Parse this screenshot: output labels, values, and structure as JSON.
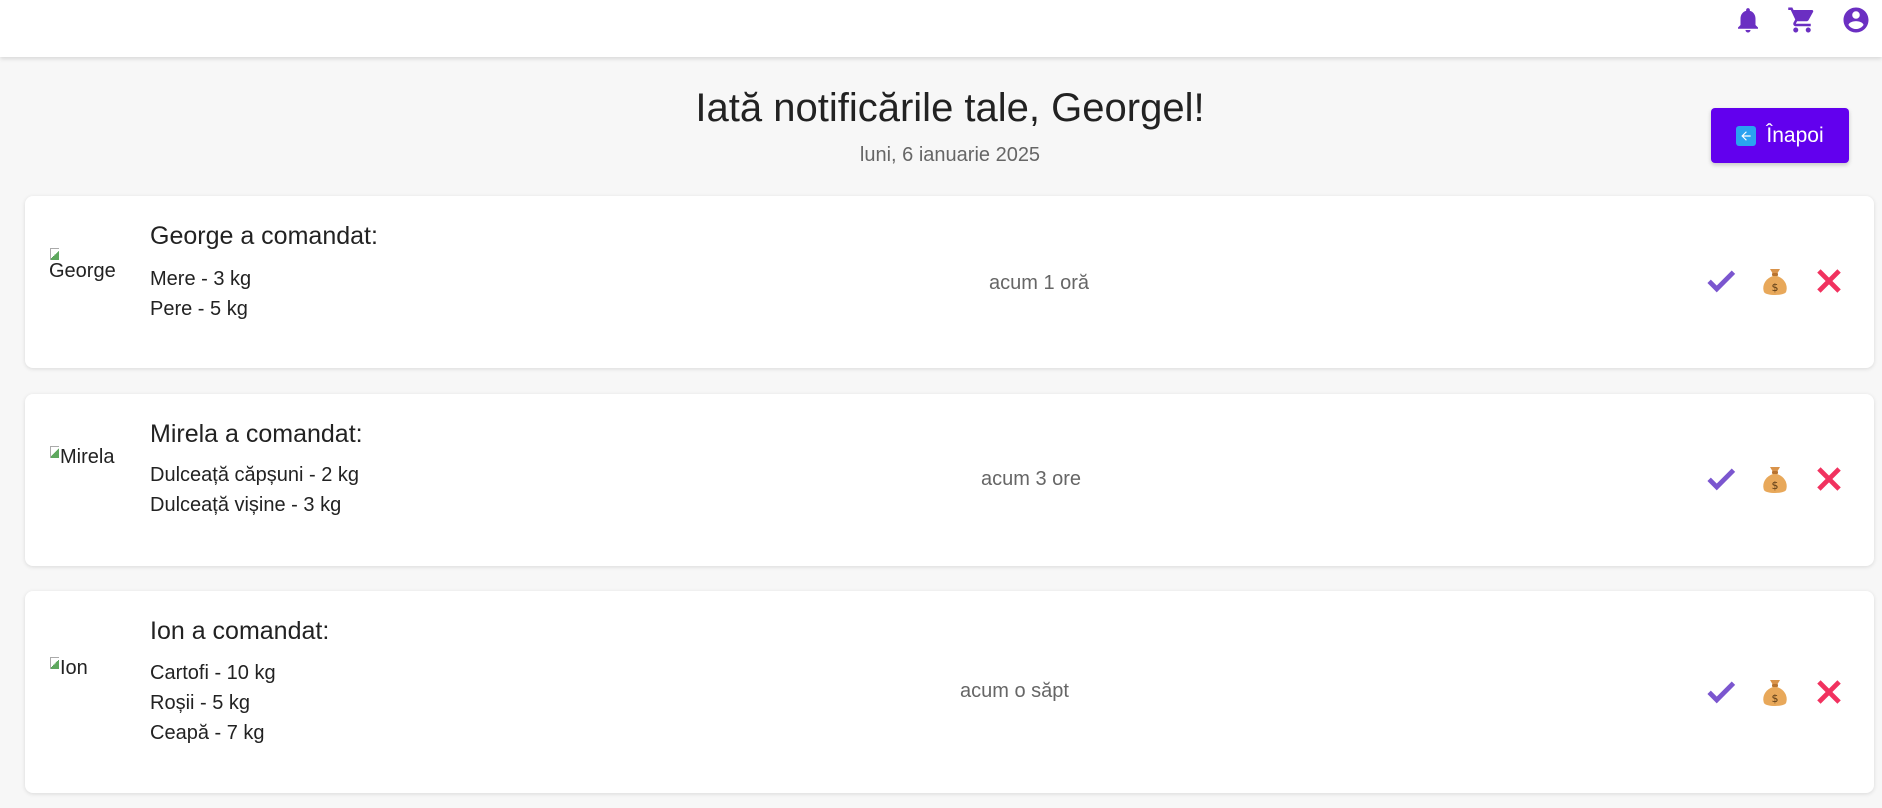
{
  "topbar": {
    "icons": [
      "bell-icon",
      "cart-icon",
      "account-circle-icon"
    ],
    "accent_color": "#6b2fc2"
  },
  "header": {
    "title": "Iată notificările tale, Georgel!",
    "date": "luni, 6 ianuarie 2025",
    "back_label": "Înapoi",
    "back_color": "#6200ee"
  },
  "notifications": [
    {
      "avatar_alt": "George",
      "heading": "George a comandat:",
      "items": [
        "Mere - 3 kg",
        "Pere - 5 kg"
      ],
      "time": "acum 1 oră"
    },
    {
      "avatar_alt": "Mirela",
      "heading": "Mirela a comandat:",
      "items": [
        "Dulceață căpșuni - 2 kg",
        "Dulceață vișine - 3 kg"
      ],
      "time": "acum 3 ore"
    },
    {
      "avatar_alt": "Ion",
      "heading": "Ion a comandat:",
      "items": [
        "Cartofi - 10 kg",
        "Roșii - 5 kg",
        "Ceapă - 7 kg"
      ],
      "time": "acum o săpt"
    }
  ],
  "action_icons": [
    "check-icon",
    "money-bag-icon",
    "close-icon"
  ],
  "colors": {
    "check": "#7b56cf",
    "reject": "#f1325f",
    "bag": "#e8a85a"
  }
}
